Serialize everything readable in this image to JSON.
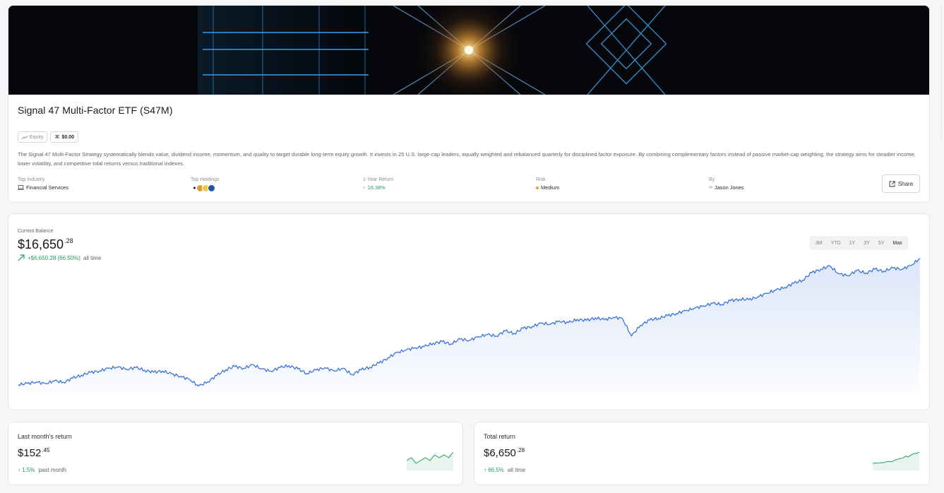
{
  "fund": {
    "title": "Signal 47 Multi-Factor ETF (S47M)",
    "tag_type": "Equity",
    "tag_price": "$0.00",
    "description": "The Signal 47 Multi-Factor Strategy systematically blends value, dividend income, momentum, and quality to target durable long-term equity growth. It invests in 25 U.S. large-cap leaders, equally weighted and rebalanced quarterly for disciplined factor exposure. By combining complementary factors instead of passive market-cap weighting, the strategy aims for steadier income, lower volatility, and competitive total returns versus traditional indexes."
  },
  "meta": {
    "industry_label": "Top Industry",
    "industry_value": "Financial Services",
    "holdings_label": "Top Holdings",
    "return_label": "1-Year Return",
    "return_value": "16.38%",
    "risk_label": "Risk",
    "risk_value": "Medium",
    "by_label": "By",
    "by_value": "Jason Jones",
    "share_label": "Share"
  },
  "icons": {
    "equity": "chart-line-icon",
    "price": "command-icon",
    "industry": "laptop-icon",
    "return": "arrow-up-icon",
    "risk": "status-dot-icon",
    "by": "link-icon",
    "share": "external-link-icon",
    "balance_trend": "trend-up-arrow-icon"
  },
  "balance": {
    "label": "Current Balance",
    "value_main": "$16,650",
    "value_cents": ".28",
    "change": "+$6,650.28 (66.50%)",
    "change_suffix": "all time"
  },
  "ranges": [
    "3M",
    "YTD",
    "1Y",
    "3Y",
    "5Y",
    "Max"
  ],
  "active_range": "Max",
  "colors": {
    "accent": "#3b74d9",
    "positive": "#1f9d63",
    "risk_medium": "#e0a42a"
  },
  "stats": {
    "month": {
      "label": "Last month's return",
      "value_main": "$152",
      "value_cents": ".45",
      "change": "↑ 1.5%",
      "suffix": "past month"
    },
    "total": {
      "label": "Total return",
      "value_main": "$6,650",
      "value_cents": ".28",
      "change": "↑ 66.5%",
      "suffix": "all time"
    }
  },
  "chart_data": {
    "type": "area",
    "x": [
      0,
      1,
      2,
      3,
      4,
      5,
      6,
      7,
      8,
      9,
      10,
      11,
      12,
      13,
      14,
      15,
      16,
      17,
      18,
      19,
      20,
      21,
      22,
      23,
      24,
      25,
      26,
      27,
      28,
      29,
      30,
      31,
      32,
      33,
      34,
      35,
      36,
      37,
      38,
      39,
      40,
      41,
      42,
      43,
      44,
      45,
      46,
      47,
      48,
      49,
      50,
      51,
      52,
      53,
      54,
      55,
      56,
      57,
      58,
      59,
      60,
      61,
      62,
      63,
      64,
      65,
      66,
      67,
      68,
      69,
      70,
      71,
      72,
      73,
      74,
      75,
      76,
      77,
      78,
      79,
      80,
      81,
      82,
      83,
      84,
      85,
      86,
      87,
      88,
      89,
      90,
      91,
      92,
      93,
      94,
      95,
      96,
      97,
      98,
      99,
      100
    ],
    "values": [
      10000,
      10060,
      10140,
      10050,
      10200,
      10120,
      10330,
      10500,
      10640,
      10720,
      10860,
      10930,
      10810,
      10900,
      10760,
      10650,
      10720,
      10560,
      10430,
      10270,
      9920,
      10150,
      10480,
      10790,
      10960,
      10860,
      11050,
      10830,
      10700,
      10900,
      11000,
      10830,
      10590,
      10770,
      10890,
      10720,
      10860,
      10530,
      10780,
      10920,
      11130,
      11410,
      11690,
      11830,
      11940,
      12000,
      12180,
      12260,
      12150,
      12400,
      12330,
      12520,
      12640,
      12560,
      12830,
      12700,
      12970,
      13060,
      13240,
      13180,
      13350,
      13260,
      13440,
      13380,
      13520,
      13420,
      13550,
      13480,
      12560,
      13130,
      13400,
      13500,
      13630,
      13750,
      13890,
      14030,
      14150,
      14280,
      14230,
      14420,
      14500,
      14480,
      14620,
      14810,
      14980,
      15120,
      15340,
      15510,
      15900,
      16080,
      16250,
      15840,
      15740,
      16010,
      15880,
      16080,
      15980,
      16150,
      16080,
      16280,
      16650
    ],
    "ylim": [
      9500,
      17500
    ],
    "xlabel": "",
    "ylabel": ""
  },
  "spark_month": [
    1,
    1.01,
    0.99,
    1,
    1.01,
    1,
    1.02,
    1.01,
    1.02,
    1.01,
    1.03
  ],
  "spark_total": [
    1,
    1.02,
    1.01,
    1.05,
    1.04,
    1.1,
    1.12,
    1.09,
    1.2,
    1.25,
    1.3,
    1.32,
    1.45,
    1.4,
    1.52,
    1.6,
    1.62,
    1.7
  ]
}
